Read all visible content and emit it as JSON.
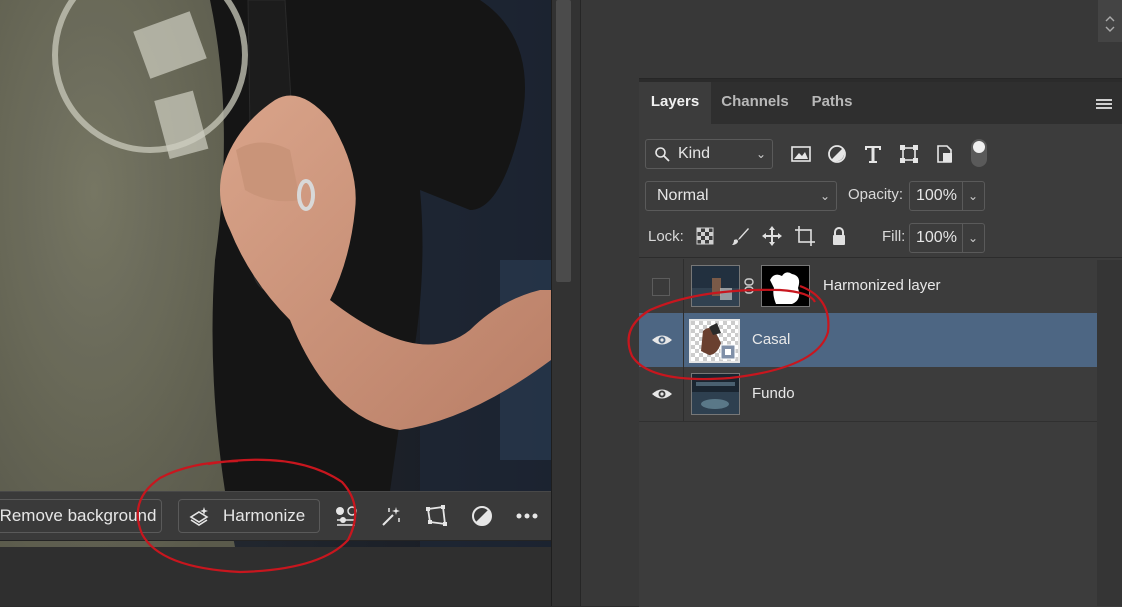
{
  "taskbar": {
    "remove_background_label": "Remove background",
    "harmonize_label": "Harmonize",
    "icons": [
      "adjust-selection-icon",
      "magic-wand-icon",
      "transform-icon",
      "adjustment-circle-icon",
      "more-icon"
    ]
  },
  "layers_panel": {
    "tabs": [
      "Layers",
      "Channels",
      "Paths"
    ],
    "filter_kind": "Kind",
    "blend_mode": "Normal",
    "opacity_label": "Opacity:",
    "opacity_value": "100%",
    "lock_label": "Lock:",
    "fill_label": "Fill:",
    "fill_value": "100%",
    "layers": [
      {
        "name": "Harmonized layer",
        "visible": false,
        "selected": false,
        "has_mask": true
      },
      {
        "name": "Casal",
        "visible": true,
        "selected": true,
        "has_mask": false
      },
      {
        "name": "Fundo",
        "visible": true,
        "selected": false,
        "has_mask": false
      }
    ]
  },
  "colors": {
    "selection": "#4d6683",
    "annotation": "#c8161e",
    "panel": "#3c3c3c"
  }
}
